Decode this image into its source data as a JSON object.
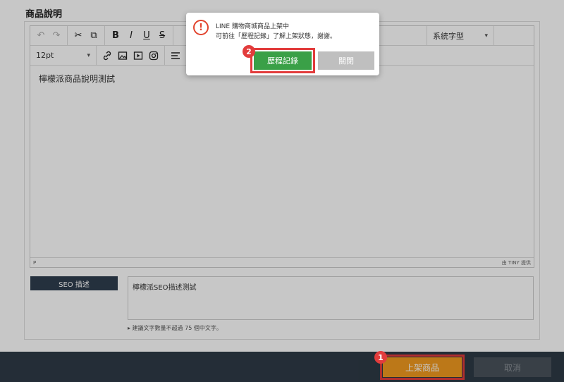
{
  "section": {
    "title": "商品說明"
  },
  "editor": {
    "toolbar": {
      "undo": "↶",
      "redo": "↷",
      "cut": "✂",
      "copy": "⧉",
      "bold": "B",
      "italic": "I",
      "underline": "U",
      "strike": "S",
      "font_family": "系統字型",
      "font_size": "12pt"
    },
    "content": "檸檬派商品說明測試",
    "status_path": "P",
    "status_brand": "由 TINY 提供"
  },
  "seo": {
    "label": "SEO 描述",
    "value": "檸檬派SEO描述測試",
    "hint": "▸ 建議文字數量不超過 75 個中文字。"
  },
  "footer": {
    "submit_label": "上架商品",
    "cancel_label": "取消"
  },
  "dialog": {
    "icon": "!",
    "title": "LINE 購物商城商品上架中",
    "message": "可前往「歷程記錄」了解上架狀態，謝謝。",
    "history_label": "歷程記錄",
    "close_label": "關閉"
  },
  "badges": {
    "one": "1",
    "two": "2"
  },
  "colors": {
    "footer_bg": "#2e3a46",
    "submit": "#f19a1f",
    "history": "#3aa047",
    "close": "#bfbfbf",
    "highlight": "#e23c3c",
    "alert": "#e2452f"
  }
}
